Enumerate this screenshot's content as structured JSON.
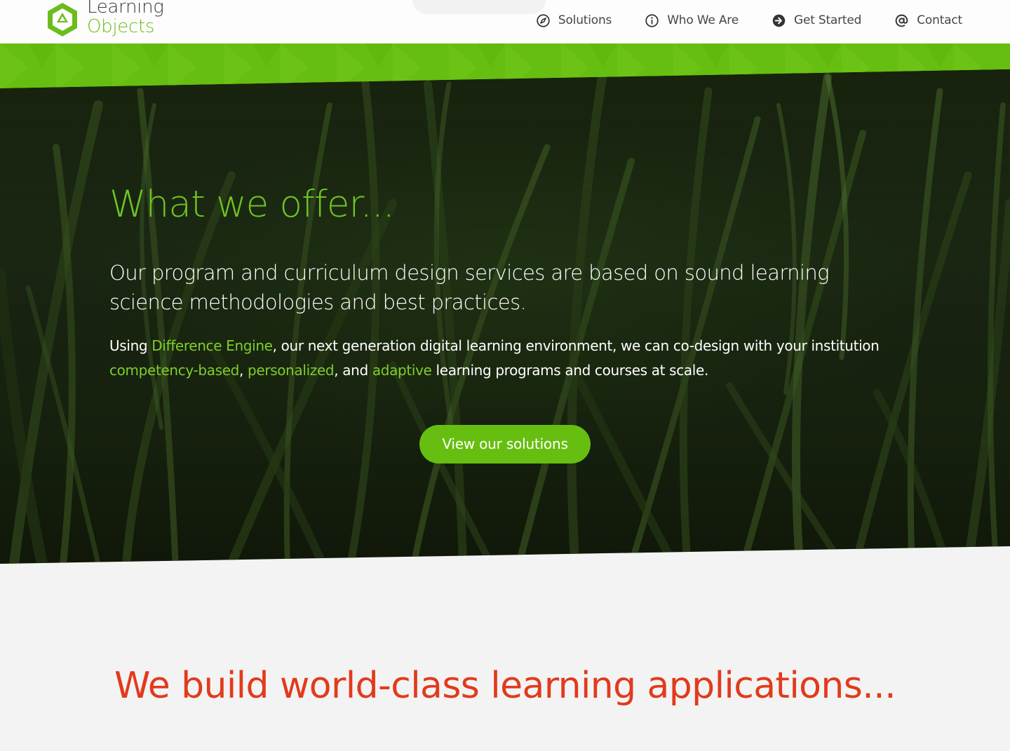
{
  "logo": {
    "line1": "Learning",
    "line2": "Objects"
  },
  "nav": {
    "items": [
      {
        "label": "Solutions",
        "icon": "compass-icon"
      },
      {
        "label": "Who We Are",
        "icon": "info-circle-icon"
      },
      {
        "label": "Get Started",
        "icon": "arrow-circle-right-icon"
      },
      {
        "label": "Contact",
        "icon": "at-sign-icon"
      }
    ]
  },
  "hero": {
    "title": "What we offer...",
    "lead": "Our program and curriculum design services are based on sound learning science methodologies and best practices.",
    "body": {
      "part1": "Using ",
      "link_engine": "Difference Engine",
      "part2": ", our next generation digital learning environment, we can co-design with your institution ",
      "link_competency": "competency-based",
      "sep1": ", ",
      "link_personalized": "personalized",
      "sep2": ", and ",
      "link_adaptive": "adaptive",
      "part3": " learning programs and courses at scale."
    },
    "cta_label": "View our solutions"
  },
  "section2": {
    "title": "We build world-class learning applications..."
  },
  "colors": {
    "brand_green": "#66bf10",
    "accent_red": "#e23a1c",
    "nav_text": "#454545"
  }
}
